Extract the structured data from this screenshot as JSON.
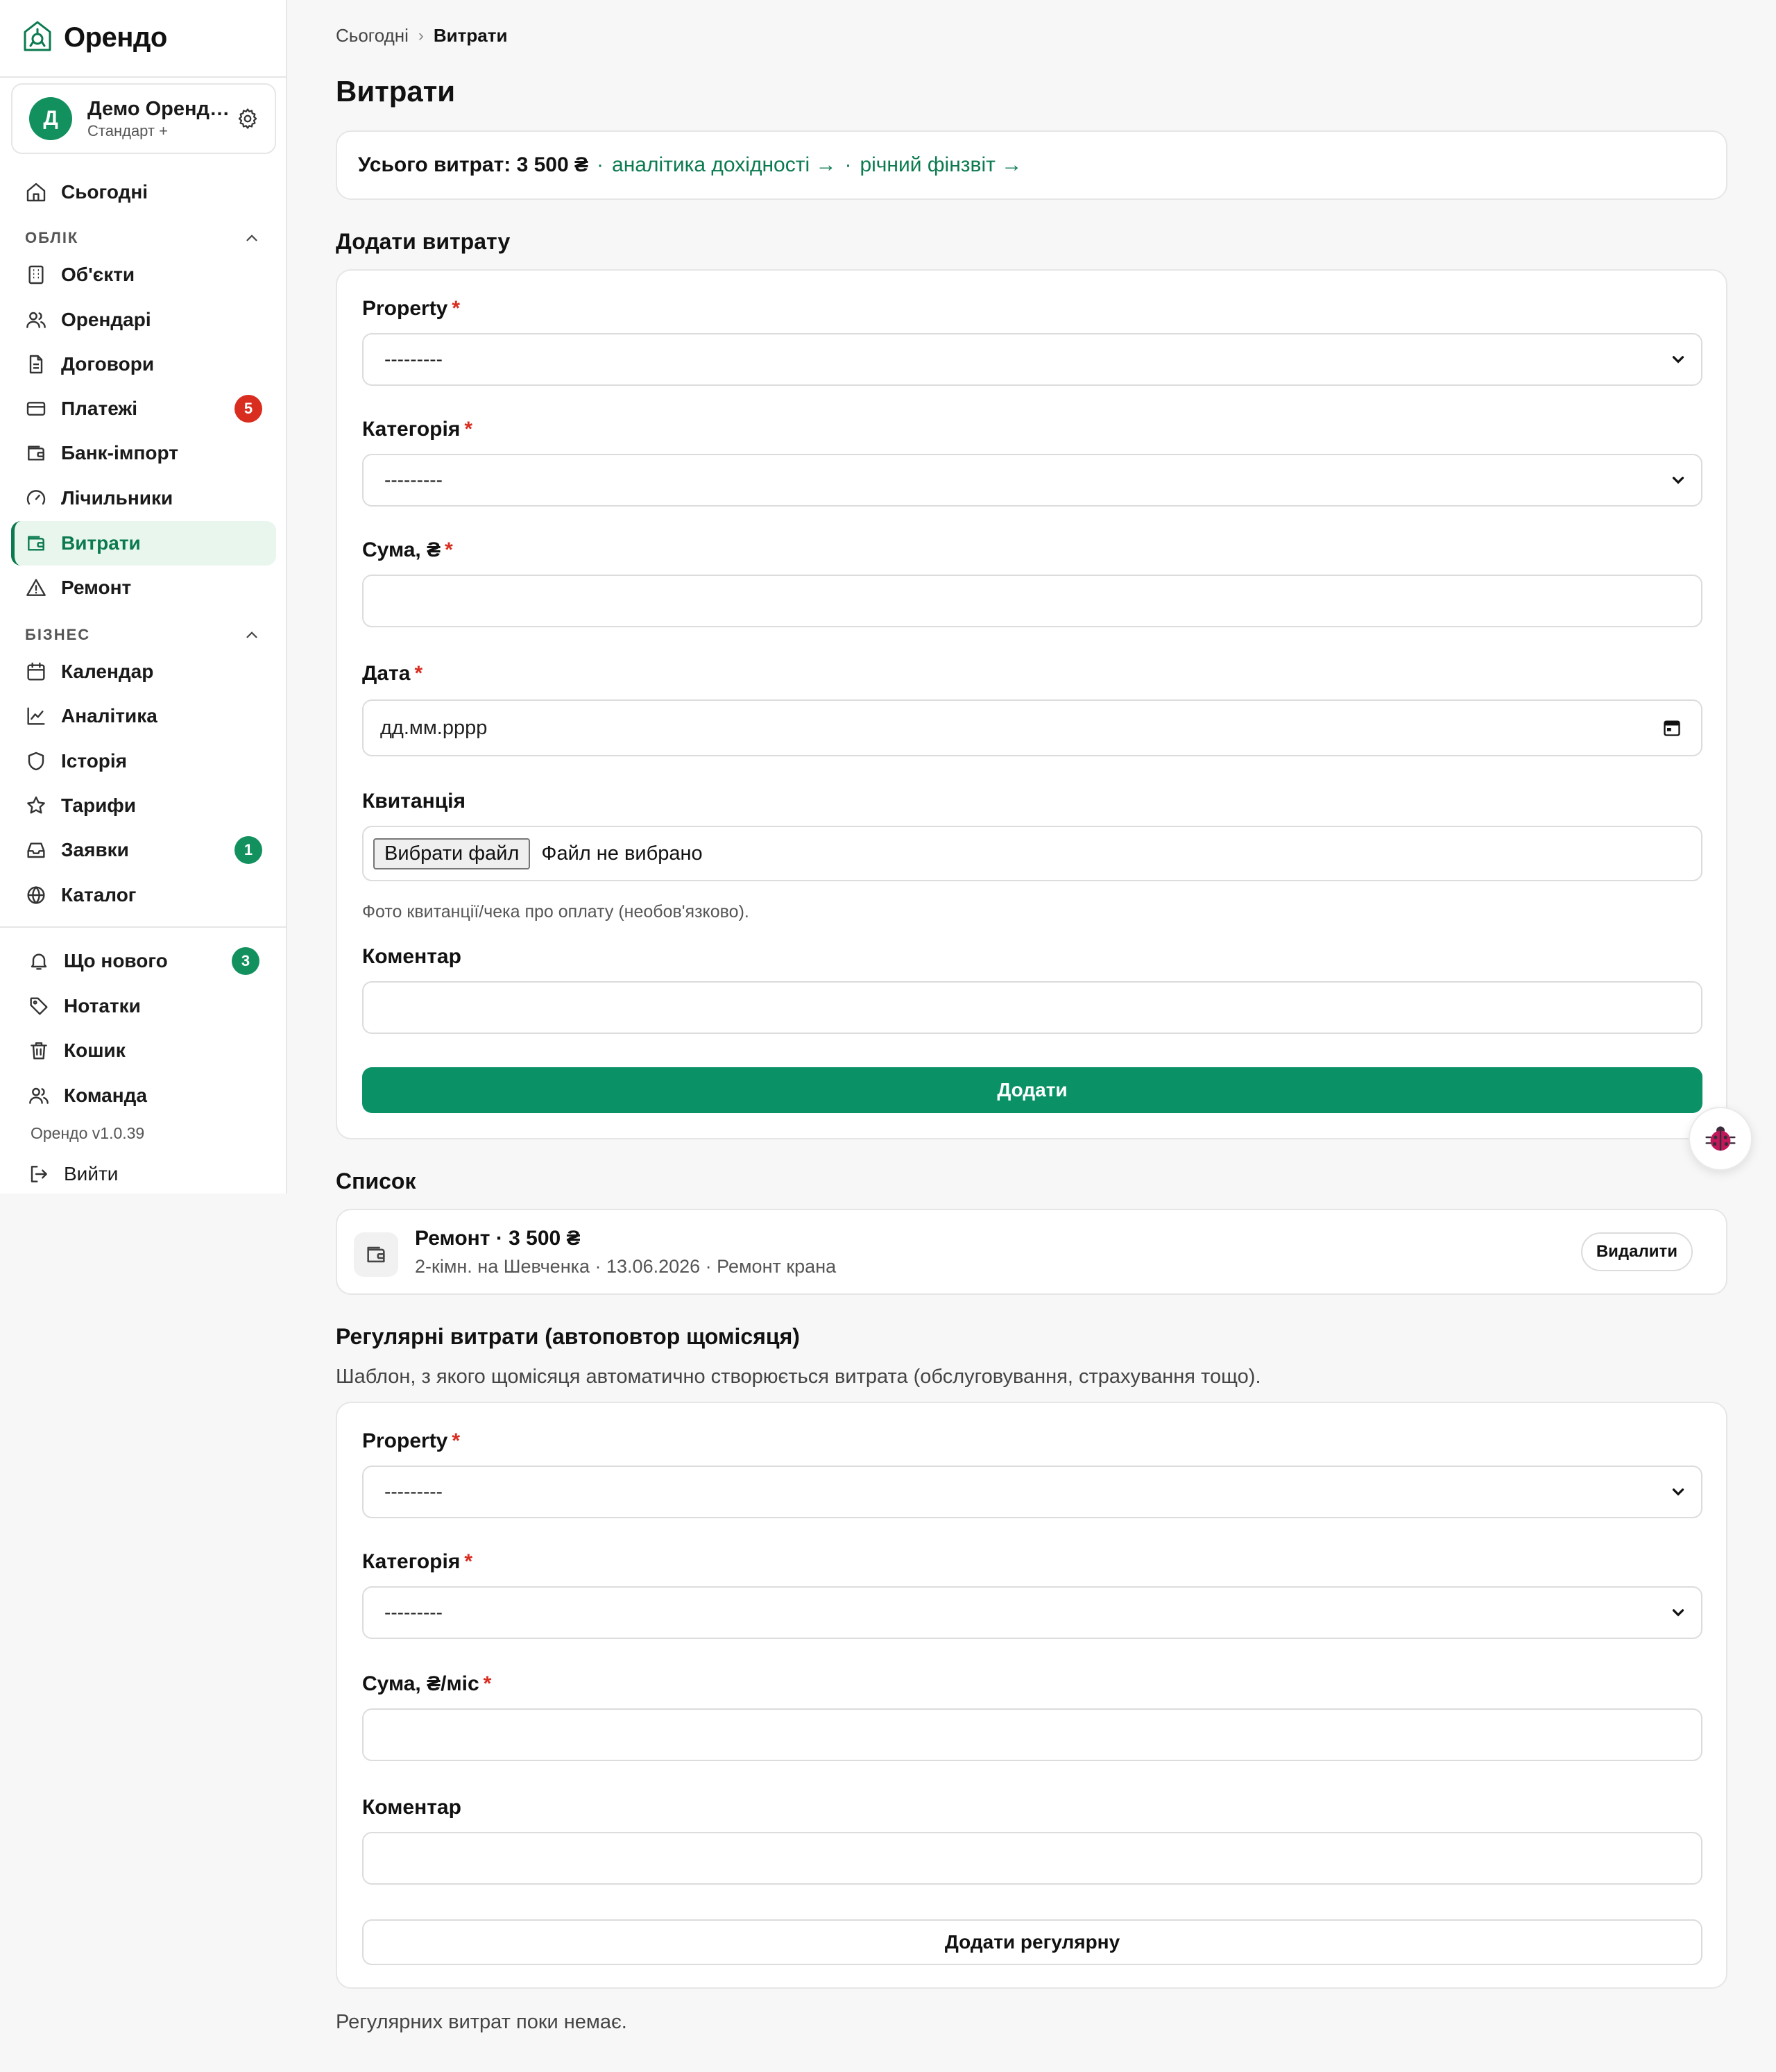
{
  "brand": {
    "name": "Орендо"
  },
  "account": {
    "initial": "Д",
    "name": "Демо Орендодавець",
    "plan": "Стандарт +"
  },
  "nav": {
    "today": "Сьогодні",
    "section_accounting": "ОБЛІК",
    "objects": "Об'єкти",
    "tenants": "Орендарі",
    "contracts": "Договори",
    "payments": "Платежі",
    "payments_badge": "5",
    "bank_import": "Банк-імпорт",
    "meters": "Лічильники",
    "expenses": "Витрати",
    "repair": "Ремонт",
    "section_business": "БІЗНЕС",
    "calendar": "Календар",
    "analytics": "Аналітика",
    "history": "Історія",
    "tariffs": "Тарифи",
    "requests": "Заявки",
    "requests_badge": "1",
    "catalog": "Каталог",
    "whats_new": "Що нового",
    "whats_new_badge": "3",
    "notes": "Нотатки",
    "trash": "Кошик",
    "team": "Команда",
    "version": "Орендо v1.0.39",
    "logout": "Вийти"
  },
  "breadcrumb": {
    "home": "Сьогодні",
    "separator": "›",
    "current": "Витрати"
  },
  "page": {
    "title": "Витрати"
  },
  "summary": {
    "total_label": "Усього витрат: 3 500 ₴",
    "dot": "·",
    "analytics_link": "аналітика дохідності →",
    "report_link": "річний фінзвіт →"
  },
  "add_form": {
    "heading": "Додати витрату",
    "property_label": "Property",
    "property_value": "---------",
    "category_label": "Категорія",
    "category_value": "---------",
    "amount_label": "Сума, ₴",
    "amount_value": "",
    "date_label": "Дата",
    "date_placeholder": "дд.мм.рррр",
    "receipt_label": "Квитанція",
    "file_button": "Вибрати файл",
    "file_status": "Файл не вибрано",
    "receipt_hint": "Фото квитанції/чека про оплату (необов'язково).",
    "comment_label": "Коментар",
    "comment_value": "",
    "submit": "Додати",
    "required_mark": "*"
  },
  "list": {
    "heading": "Список",
    "items": [
      {
        "title": "Ремонт · 3 500 ₴",
        "subtitle": "2-кімн. на Шевченка · 13.06.2026 · Ремонт крана",
        "delete": "Видалити"
      }
    ]
  },
  "recurring": {
    "heading": "Регулярні витрати (автоповтор щомісяця)",
    "description": "Шаблон, з якого щомісяця автоматично створюється витрата (обслуговування, страхування тощо).",
    "property_label": "Property",
    "property_value": "---------",
    "category_label": "Категорія",
    "category_value": "---------",
    "amount_label": "Сума, ₴/міс",
    "amount_value": "",
    "comment_label": "Коментар",
    "comment_value": "",
    "submit": "Додати регулярну",
    "empty": "Регулярних витрат поки немає."
  },
  "colors": {
    "accent": "#0a9266",
    "accent_dark": "#0b7a4f",
    "danger": "#d92d20",
    "active_bg": "#e8f6ee"
  },
  "icons": {
    "logo": "house-leaf-logo",
    "gear": "gear-icon",
    "today": "home-icon",
    "objects": "building-icon",
    "tenants": "users-icon",
    "contracts": "document-icon",
    "payments": "card-icon",
    "bank_import": "wallet-icon",
    "meters": "gauge-icon",
    "expenses": "wallet-icon",
    "repair": "warning-icon",
    "calendar": "calendar-icon",
    "analytics": "chart-line-icon",
    "history": "shield-icon",
    "tariffs": "star-icon",
    "requests": "inbox-icon",
    "catalog": "globe-icon",
    "whats_new": "bell-icon",
    "notes": "tag-icon",
    "trash": "trash-icon",
    "team": "users-icon",
    "logout": "logout-icon",
    "bug": "ladybug-icon"
  }
}
